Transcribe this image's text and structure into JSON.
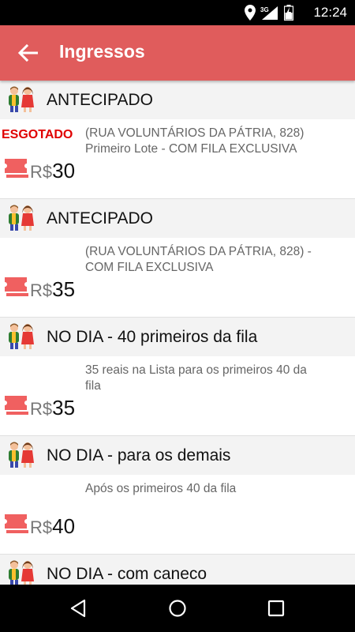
{
  "status_bar": {
    "time": "12:24",
    "network": "3G"
  },
  "app_bar": {
    "title": "Ingressos"
  },
  "sections": [
    {
      "title": "ANTECIPADO",
      "soldout": "ESGOTADO",
      "currency": "R$",
      "price": "30",
      "desc": "(RUA VOLUNTÁRIOS DA PÁTRIA, 828) Primeiro Lote - COM FILA EXCLUSIVA"
    },
    {
      "title": "ANTECIPADO",
      "soldout": "",
      "currency": "R$",
      "price": "35",
      "desc": "(RUA VOLUNTÁRIOS DA PÁTRIA, 828) - COM FILA EXCLUSIVA"
    },
    {
      "title": "NO DIA - 40 primeiros da fila",
      "soldout": "",
      "currency": "R$",
      "price": "35",
      "desc": "35 reais na Lista para os primeiros 40 da fila"
    },
    {
      "title": "NO DIA - para os demais",
      "soldout": "",
      "currency": "R$",
      "price": "40",
      "desc": "Após os primeiros 40 da fila"
    },
    {
      "title": "NO DIA - com caneco"
    }
  ],
  "colors": {
    "app_bar": "#e05c5c",
    "soldout": "#e00000",
    "ticket": "#f06060"
  }
}
